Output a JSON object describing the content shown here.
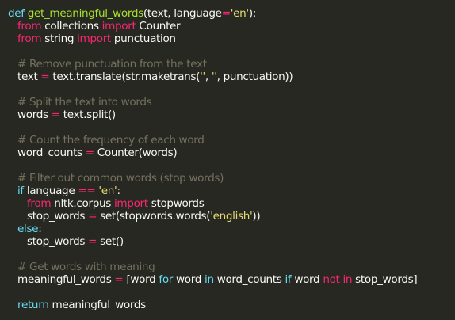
{
  "code": {
    "language": "python",
    "lines": [
      {
        "indent": 0,
        "tokens": [
          {
            "t": "kw",
            "v": "def "
          },
          {
            "t": "fn",
            "v": "get_meaningful_words"
          },
          {
            "t": "tx",
            "v": "(text, language"
          },
          {
            "t": "op",
            "v": "="
          },
          {
            "t": "str",
            "v": "'en'"
          },
          {
            "t": "tx",
            "v": "):"
          }
        ]
      },
      {
        "indent": 1,
        "tokens": [
          {
            "t": "imp",
            "v": "from"
          },
          {
            "t": "tx",
            "v": " collections "
          },
          {
            "t": "imp",
            "v": "import"
          },
          {
            "t": "tx",
            "v": " Counter"
          }
        ]
      },
      {
        "indent": 1,
        "tokens": [
          {
            "t": "imp",
            "v": "from"
          },
          {
            "t": "tx",
            "v": " string "
          },
          {
            "t": "imp",
            "v": "import"
          },
          {
            "t": "tx",
            "v": " punctuation"
          }
        ]
      },
      {
        "indent": 0,
        "tokens": []
      },
      {
        "indent": 1,
        "tokens": [
          {
            "t": "cm",
            "v": "# Remove punctuation from the text"
          }
        ]
      },
      {
        "indent": 1,
        "tokens": [
          {
            "t": "tx",
            "v": "text "
          },
          {
            "t": "op",
            "v": "="
          },
          {
            "t": "tx",
            "v": " text.translate(str.maketrans("
          },
          {
            "t": "str",
            "v": "''"
          },
          {
            "t": "tx",
            "v": ", "
          },
          {
            "t": "str",
            "v": "''"
          },
          {
            "t": "tx",
            "v": ", punctuation))"
          }
        ]
      },
      {
        "indent": 0,
        "tokens": []
      },
      {
        "indent": 1,
        "tokens": [
          {
            "t": "cm",
            "v": "# Split the text into words"
          }
        ]
      },
      {
        "indent": 1,
        "tokens": [
          {
            "t": "tx",
            "v": "words "
          },
          {
            "t": "op",
            "v": "="
          },
          {
            "t": "tx",
            "v": " text.split()"
          }
        ]
      },
      {
        "indent": 0,
        "tokens": []
      },
      {
        "indent": 1,
        "tokens": [
          {
            "t": "cm",
            "v": "# Count the frequency of each word"
          }
        ]
      },
      {
        "indent": 1,
        "tokens": [
          {
            "t": "tx",
            "v": "word_counts "
          },
          {
            "t": "op",
            "v": "="
          },
          {
            "t": "tx",
            "v": " Counter(words)"
          }
        ]
      },
      {
        "indent": 0,
        "tokens": []
      },
      {
        "indent": 1,
        "tokens": [
          {
            "t": "cm",
            "v": "# Filter out common words (stop words)"
          }
        ]
      },
      {
        "indent": 1,
        "tokens": [
          {
            "t": "kw",
            "v": "if"
          },
          {
            "t": "tx",
            "v": " language "
          },
          {
            "t": "op",
            "v": "=="
          },
          {
            "t": "tx",
            "v": " "
          },
          {
            "t": "str",
            "v": "'en'"
          },
          {
            "t": "tx",
            "v": ":"
          }
        ]
      },
      {
        "indent": 2,
        "tokens": [
          {
            "t": "imp",
            "v": "from"
          },
          {
            "t": "tx",
            "v": " nltk.corpus "
          },
          {
            "t": "imp",
            "v": "import"
          },
          {
            "t": "tx",
            "v": " stopwords"
          }
        ]
      },
      {
        "indent": 2,
        "tokens": [
          {
            "t": "tx",
            "v": "stop_words "
          },
          {
            "t": "op",
            "v": "="
          },
          {
            "t": "tx",
            "v": " set(stopwords.words("
          },
          {
            "t": "str",
            "v": "'english'"
          },
          {
            "t": "tx",
            "v": "))"
          }
        ]
      },
      {
        "indent": 1,
        "tokens": [
          {
            "t": "kw",
            "v": "else"
          },
          {
            "t": "tx",
            "v": ":"
          }
        ]
      },
      {
        "indent": 2,
        "tokens": [
          {
            "t": "tx",
            "v": "stop_words "
          },
          {
            "t": "op",
            "v": "="
          },
          {
            "t": "tx",
            "v": " set()"
          }
        ]
      },
      {
        "indent": 0,
        "tokens": []
      },
      {
        "indent": 1,
        "tokens": [
          {
            "t": "cm",
            "v": "# Get words with meaning"
          }
        ]
      },
      {
        "indent": 1,
        "tokens": [
          {
            "t": "tx",
            "v": "meaningful_words "
          },
          {
            "t": "op",
            "v": "="
          },
          {
            "t": "tx",
            "v": " [word "
          },
          {
            "t": "kw",
            "v": "for"
          },
          {
            "t": "tx",
            "v": " word "
          },
          {
            "t": "kw",
            "v": "in"
          },
          {
            "t": "tx",
            "v": " word_counts "
          },
          {
            "t": "kw",
            "v": "if"
          },
          {
            "t": "tx",
            "v": " word "
          },
          {
            "t": "op",
            "v": "not in"
          },
          {
            "t": "tx",
            "v": " stop_words]"
          }
        ]
      },
      {
        "indent": 0,
        "tokens": []
      },
      {
        "indent": 1,
        "tokens": [
          {
            "t": "kw",
            "v": "return"
          },
          {
            "t": "tx",
            "v": " meaningful_words"
          }
        ]
      }
    ]
  },
  "colors": {
    "background": "#272822",
    "text": "#f8f8f2",
    "keyword": "#66d9ef",
    "import_keyword": "#f92672",
    "operator": "#f92672",
    "function_name": "#a6e22e",
    "string": "#e6db74",
    "comment": "#75715e"
  }
}
